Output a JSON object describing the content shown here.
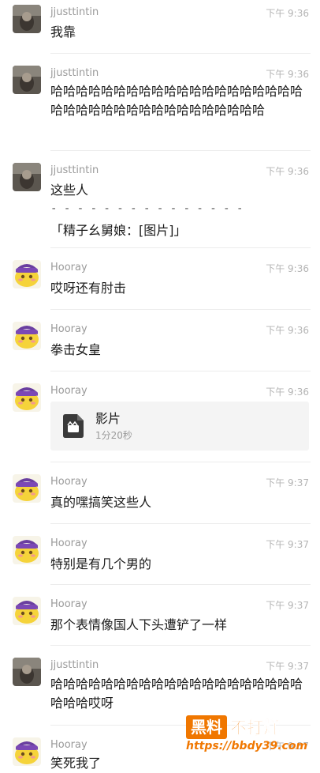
{
  "messages": [
    {
      "sender": "jjusttintin",
      "time": "下午 9:36",
      "text": "我靠"
    },
    {
      "sender": "jjusttintin",
      "time": "下午 9:36",
      "text": "哈哈哈哈哈哈哈哈哈哈哈哈哈哈哈哈哈哈哈哈哈哈哈哈哈哈哈哈哈哈哈哈哈哈哈哈哈"
    },
    {
      "sender": "jjusttintin",
      "time": "下午 9:36",
      "text": "这些人",
      "quote_separator": "- - - - - - - - - - - - - - -",
      "quote": "「精子幺舅娘：[图片]」"
    },
    {
      "sender": "Hooray",
      "time": "下午 9:36",
      "text": "哎呀还有肘击"
    },
    {
      "sender": "Hooray",
      "time": "下午 9:36",
      "text": "拳击女皇"
    },
    {
      "sender": "Hooray",
      "time": "下午 9:36",
      "video": {
        "title": "影片",
        "duration": "1分20秒"
      }
    },
    {
      "sender": "Hooray",
      "time": "下午 9:37",
      "text": "真的嘿搞笑这些人"
    },
    {
      "sender": "Hooray",
      "time": "下午 9:37",
      "text": "特别是有几个男的"
    },
    {
      "sender": "Hooray",
      "time": "下午 9:37",
      "text": "那个表情像国人下头遭铲了一样"
    },
    {
      "sender": "jjusttintin",
      "time": "下午 9:37",
      "text": "哈哈哈哈哈哈哈哈哈哈哈哈哈哈哈哈哈哈哈哈哈哈哈哎呀"
    },
    {
      "sender": "Hooray",
      "time": "下午 9:37",
      "text": "笑死我了"
    }
  ],
  "watermark": {
    "badge": "黑料",
    "text": "不打烊",
    "url": "https://bbdy39.com"
  },
  "colors": {
    "watermark": "#f07700",
    "name": "#9a9a9a",
    "time": "#b4b4b4",
    "text": "#1a1a1a"
  }
}
